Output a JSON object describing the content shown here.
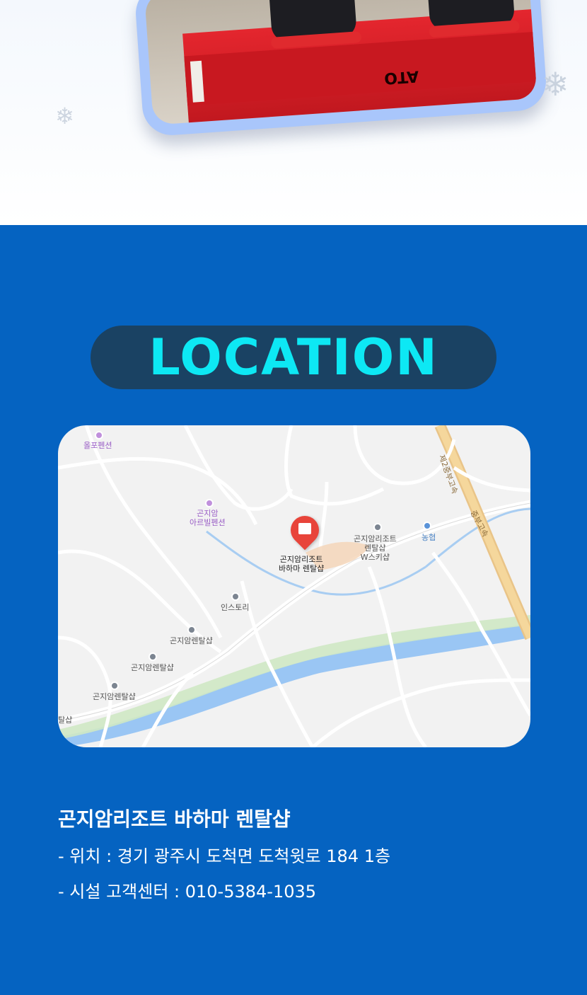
{
  "photo": {
    "brand_text": "ATO",
    "colors": {
      "card_border": "#a9c6fb",
      "box_red": "#e4262e"
    }
  },
  "location": {
    "title": "LOCATION",
    "colors": {
      "background": "#0563c1",
      "pill": "#1a4263",
      "title": "#0de8f4"
    },
    "map": {
      "labels": {
        "olpo": "올포펜션",
        "gonjiam_art": "곤지암\n아르빌펜션",
        "main_pin": "곤지암리조트\n바하마 렌탈샵",
        "w_ski": "곤지암리조트\n렌탈샵\nW스키샵",
        "nonghyup": "농협",
        "instory": "인스토리",
        "rental1": "곤지암렌탈샵",
        "rental2": "곤지암렌탈샵",
        "rental3": "곤지암렌탈샵",
        "rental_edge": "탈샵",
        "highway2": "제2중부고속",
        "highway": "중부고속"
      }
    },
    "info": {
      "name": "곤지암리조트 바하마 렌탈샵",
      "address": "- 위치 : 경기 광주시 도척면 도척윗로 184 1층",
      "phone": "- 시설 고객센터 : 010-5384-1035"
    }
  }
}
